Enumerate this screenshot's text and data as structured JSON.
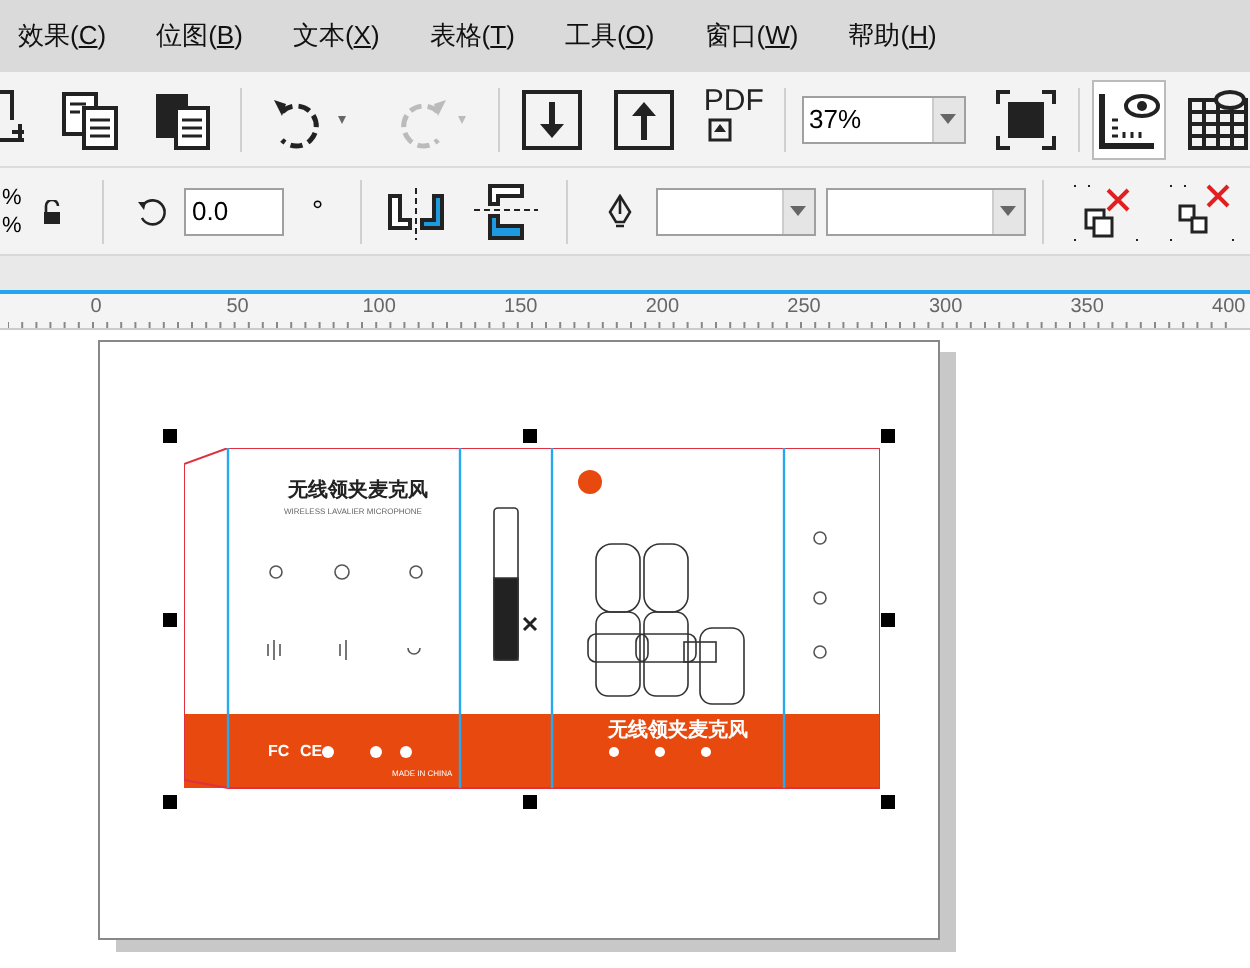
{
  "menu": [
    {
      "label": "效果(C)"
    },
    {
      "label": "位图(B)"
    },
    {
      "label": "文本(X)"
    },
    {
      "label": "表格(T)"
    },
    {
      "label": "工具(O)"
    },
    {
      "label": "窗口(W)"
    },
    {
      "label": "帮助(H)"
    }
  ],
  "toolbar": {
    "pdf_label": "PDF",
    "zoom": "37%",
    "grid_active": true
  },
  "property_bar": {
    "percent_top": "%",
    "percent_bottom": "%",
    "rotation": "0.0",
    "degree": "°"
  },
  "ruler": {
    "labels": [
      "0",
      "50",
      "100",
      "150",
      "200",
      "250",
      "300",
      "350",
      "400"
    ]
  },
  "artwork": {
    "title": "无线领夹麦克风",
    "subtitle": "WIRELESS LAVALIER MICROPHONE",
    "marks": [
      "FC",
      "CE"
    ],
    "origin": "MADE IN CHINA",
    "band_title": "无线领夹麦克风"
  }
}
